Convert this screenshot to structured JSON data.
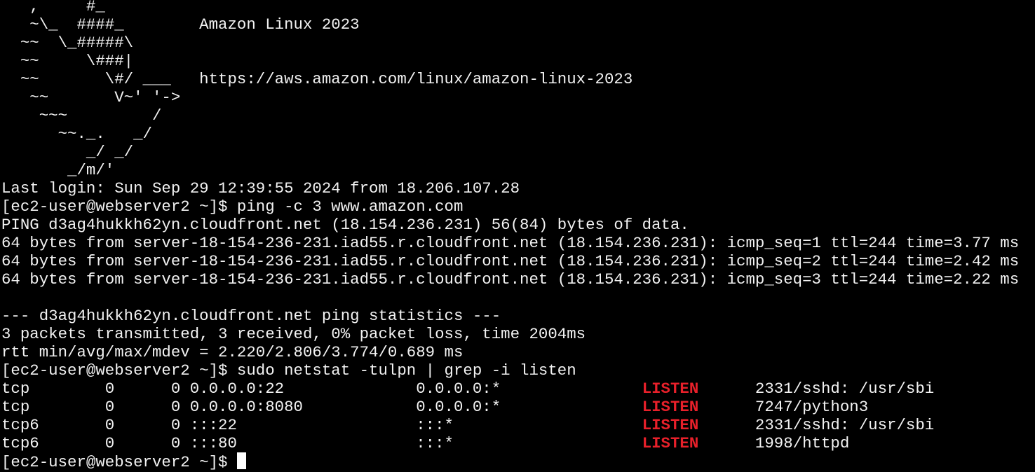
{
  "banner": {
    "art": [
      "   ,     #_",
      "   ~\\_  ####_        Amazon Linux 2023",
      "  ~~  \\_#####\\",
      "  ~~     \\###|",
      "  ~~       \\#/ ___   https://aws.amazon.com/linux/amazon-linux-2023",
      "   ~~       V~' '->",
      "    ~~~         /",
      "      ~~._.   _/",
      "         _/ _/",
      "       _/m/'"
    ]
  },
  "session": {
    "last_login": "Last login: Sun Sep 29 12:39:55 2024 from 18.206.107.28",
    "prompt": "[ec2-user@webserver2 ~]$ ",
    "cmd_ping": "ping -c 3 www.amazon.com",
    "ping_header": "PING d3ag4hukkh62yn.cloudfront.net (18.154.236.231) 56(84) bytes of data.",
    "ping_replies": [
      "64 bytes from server-18-154-236-231.iad55.r.cloudfront.net (18.154.236.231): icmp_seq=1 ttl=244 time=3.77 ms",
      "64 bytes from server-18-154-236-231.iad55.r.cloudfront.net (18.154.236.231): icmp_seq=2 ttl=244 time=2.42 ms",
      "64 bytes from server-18-154-236-231.iad55.r.cloudfront.net (18.154.236.231): icmp_seq=3 ttl=244 time=2.22 ms"
    ],
    "ping_stats_title": "--- d3ag4hukkh62yn.cloudfront.net ping statistics ---",
    "ping_stats_packets": "3 packets transmitted, 3 received, 0% packet loss, time 2004ms",
    "ping_stats_rtt": "rtt min/avg/max/mdev = 2.220/2.806/3.774/0.689 ms",
    "cmd_netstat": "sudo netstat -tulpn | grep -i listen",
    "netstat_rows": [
      {
        "prefix": "tcp        0      0 0.0.0.0:22              0.0.0.0:*               ",
        "state": "LISTEN",
        "suffix": "      2331/sshd: /usr/sbi"
      },
      {
        "prefix": "tcp        0      0 0.0.0.0:8080            0.0.0.0:*               ",
        "state": "LISTEN",
        "suffix": "      7247/python3"
      },
      {
        "prefix": "tcp6       0      0 :::22                   :::*                    ",
        "state": "LISTEN",
        "suffix": "      2331/sshd: /usr/sbi"
      },
      {
        "prefix": "tcp6       0      0 :::80                   :::*                    ",
        "state": "LISTEN",
        "suffix": "      1998/httpd"
      }
    ]
  },
  "colors": {
    "background": "#000000",
    "foreground": "#f2f2f2",
    "listen": "#e8202a",
    "cursor": "#ffffff"
  }
}
